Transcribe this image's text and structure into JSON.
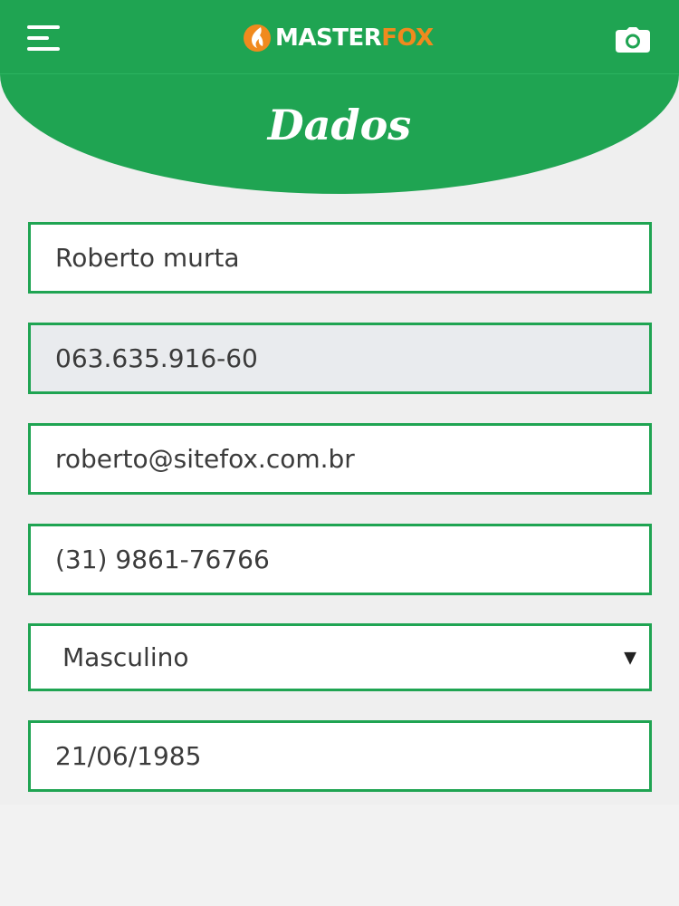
{
  "header": {
    "logo": {
      "part1": "MASTER",
      "part2": "FOX"
    },
    "menu_icon": "hamburger-icon",
    "camera_icon": "camera-icon"
  },
  "page": {
    "title": "Dados"
  },
  "form": {
    "name": "Roberto murta",
    "cpf": "063.635.916-60",
    "email": "roberto@sitefox.com.br",
    "phone": "(31) 9861-76766",
    "gender": "Masculino",
    "birthdate": "21/06/1985"
  },
  "colors": {
    "brand_green": "#1fa452",
    "logo_orange": "#f08a1e",
    "readonly_field": "#e9ebee"
  }
}
